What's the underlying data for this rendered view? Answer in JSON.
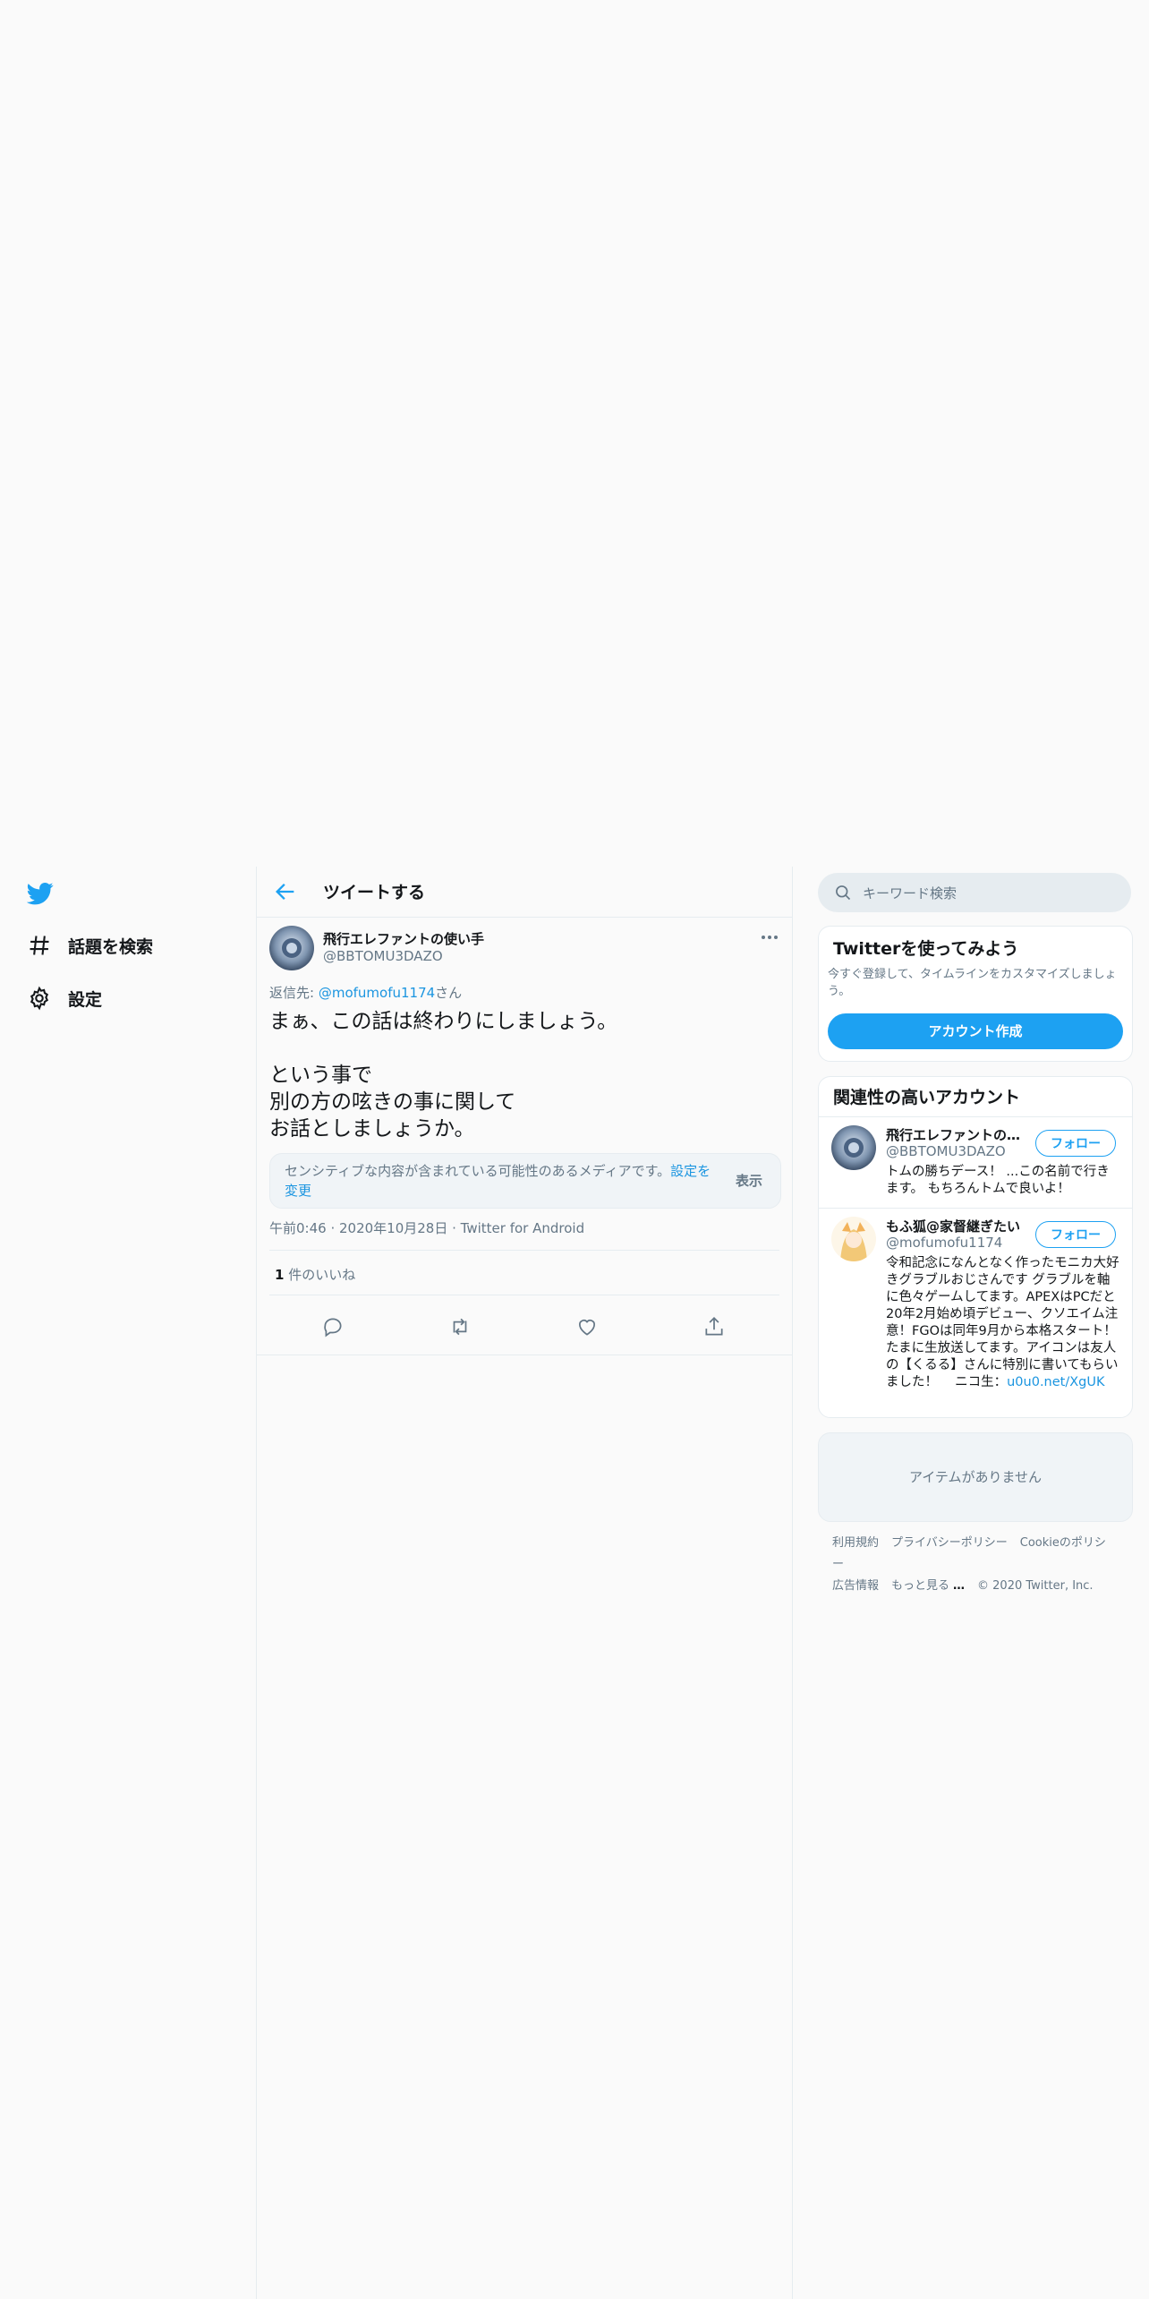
{
  "nav": {
    "items": [
      {
        "label": "話題を検索",
        "icon": "hashtag-icon"
      },
      {
        "label": "設定",
        "icon": "gear-icon"
      }
    ]
  },
  "header": {
    "title": "ツイートする"
  },
  "tweet": {
    "author_name": "飛行エレファントの使い手",
    "author_handle": "@BBTOMU3DAZO",
    "reply_prefix": "返信先: ",
    "reply_to": "@mofumofu1174",
    "reply_suffix": "さん",
    "text": "まぁ、この話は終わりにしましょう。\n\nという事で\n別の方の呟きの事に関して\nお話としましょうか。",
    "sensitive_notice": "センシティブな内容が含まれている可能性のあるメディアです。",
    "sensitive_settings_link": "設定を変更",
    "show_button": "表示",
    "time": "午前0:46",
    "date": "2020年10月28日",
    "client": "Twitter for Android",
    "likes_count": "1",
    "likes_label": " 件のいいね"
  },
  "search": {
    "placeholder": "キーワード検索"
  },
  "signup": {
    "title": "Twitterを使ってみよう",
    "description": "今すぐ登録して、タイムラインをカスタマイズしましょう。",
    "button": "アカウント作成"
  },
  "related": {
    "title": "関連性の高いアカウント",
    "follow_label": "フォロー",
    "accounts": [
      {
        "name": "飛行エレファントの使い手",
        "handle": "@BBTOMU3DAZO",
        "bio": "トムの勝ちデース！ ...この名前で行きます。 もちろんトムで良いよ！"
      },
      {
        "name": "もふ狐@家督継ぎたい",
        "handle": "@mofumofu1174",
        "bio": "令和記念になんとなく作ったモニカ大好きグラブルおじさんです グラブルを軸に色々ゲームしてます。APEXはPCだと20年2月始め頃デビュー、クソエイム注意！FGOは同年9月から本格スタート！ たまに生放送してます。アイコンは友人の【くるる】さんに特別に書いてもらいました！　 ニコ生：",
        "bio_link": "u0u0.net/XgUK"
      }
    ]
  },
  "empty_panel": {
    "text": "アイテムがありません"
  },
  "footer": {
    "links": [
      "利用規約",
      "プライバシーポリシー",
      "Cookieのポリシー",
      "広告情報"
    ],
    "more": "もっと見る",
    "copyright": "© 2020 Twitter, Inc."
  },
  "colors": {
    "accent": "#1da1f2",
    "link": "#1b95e0",
    "muted": "#657786",
    "border": "#e6ecf0"
  }
}
